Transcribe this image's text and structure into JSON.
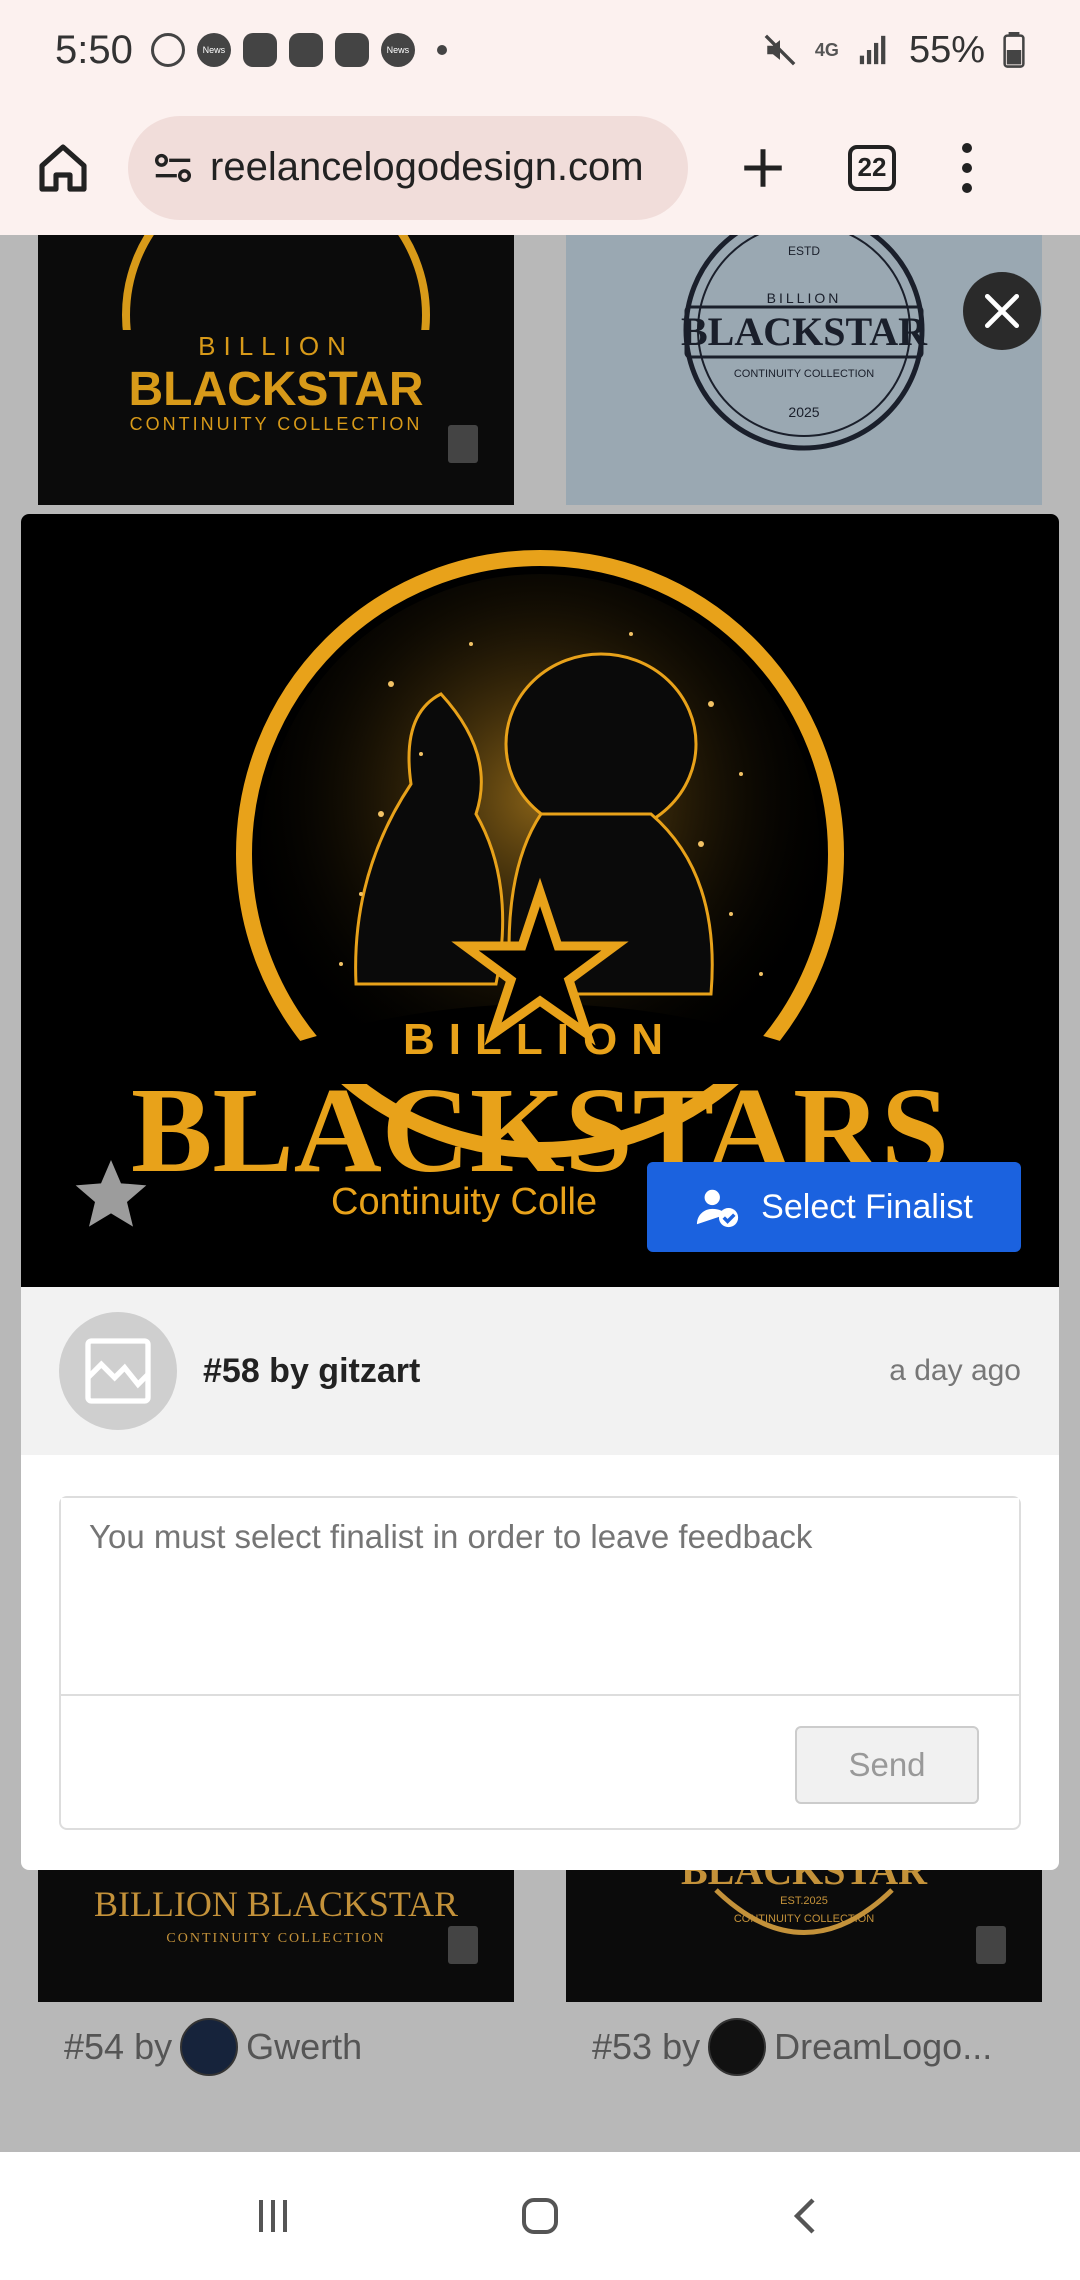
{
  "status_bar": {
    "time": "5:50",
    "notif_icons": [
      "whatsapp-icon",
      "news-icon",
      "wallet-icon",
      "wallet-icon",
      "wallet-icon",
      "news-icon"
    ],
    "badge_news": "News",
    "battery": "55%",
    "network": "4G"
  },
  "browser": {
    "url": "reelancelogodesign.com",
    "tab_count": "22"
  },
  "background_entries": [
    {
      "number": "#54 by",
      "designer": "Gwerth"
    },
    {
      "number": "#53 by",
      "designer": "DreamLogo..."
    }
  ],
  "modal": {
    "logo": {
      "line1": "BILLION",
      "line2": "BLACKSTARS",
      "line3": "Continuity Colle"
    },
    "select_finalist_label": "Select Finalist",
    "entry_title": "#58 by gitzart",
    "entry_time": "a day ago",
    "feedback_placeholder": "You must select finalist in order to leave feedback",
    "send_label": "Send"
  },
  "bg_logos": {
    "top_left": {
      "line1": "BILLION",
      "line2": "BLACKSTAR",
      "line3": "CONTINUITY COLLECTION"
    },
    "top_right": {
      "line1": "ESTD",
      "line2": "BILLION",
      "line3": "BLACKSTAR",
      "line4": "CONTINUITY COLLECTION",
      "year": "2025"
    },
    "bottom_left": {
      "line1": "BILLION BLACKSTAR",
      "line2": "CONTINUITY COLLECTION"
    },
    "bottom_right": {
      "line1": "BLACKSTAR",
      "line2": "EST.2025",
      "line3": "CONTINUITY COLLECTION"
    }
  },
  "colors": {
    "gold": "#e8a21a",
    "finalist_blue": "#1b62df"
  }
}
